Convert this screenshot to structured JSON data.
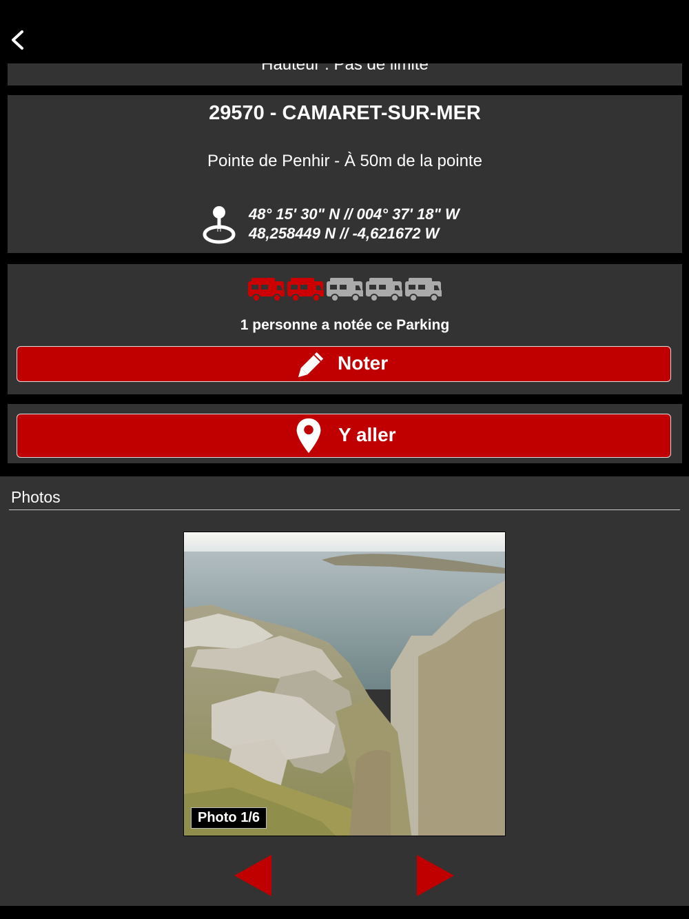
{
  "header": {
    "back_icon": "chevron-left-icon"
  },
  "hauteur": {
    "text": "Hauteur : Pas de limite"
  },
  "location": {
    "title": "29570 - CAMARET-SUR-MER",
    "subtitle": "Pointe de Penhir - À 50m de la pointe",
    "coord_dms": "48° 15' 30\" N // 004° 37' 18\" W",
    "coord_decimal": "48,258449 N // -4,621672 W",
    "icon": "gps-pin-icon"
  },
  "rating": {
    "value": 2,
    "max": 5,
    "icon": "camper-van-icon",
    "active_color": "#cc0000",
    "inactive_color": "#aaaaaa",
    "text": "1 personne a notée ce Parking",
    "button_label": "Noter",
    "button_icon": "pencil-icon"
  },
  "navigate": {
    "button_label": "Y aller",
    "button_icon": "map-pin-icon"
  },
  "photos": {
    "header": "Photos",
    "label": "Photo 1/6",
    "prev_icon": "triangle-left-icon",
    "next_icon": "triangle-right-icon"
  },
  "colors": {
    "accent": "#c00000",
    "panel": "#333333",
    "background": "#000000"
  }
}
